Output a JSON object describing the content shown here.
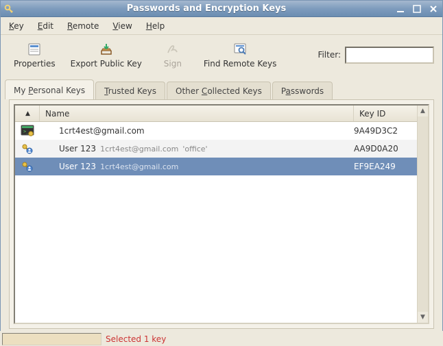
{
  "window": {
    "title": "Passwords and Encryption Keys"
  },
  "menu": {
    "key": "Key",
    "edit": "Edit",
    "remote": "Remote",
    "view": "View",
    "help": "Help"
  },
  "toolbar": {
    "properties": "Properties",
    "export": "Export Public Key",
    "sign": "Sign",
    "find_remote": "Find Remote Keys",
    "filter_label": "Filter:",
    "filter_value": ""
  },
  "tabs": {
    "personal": "My Personal Keys",
    "trusted": "Trusted Keys",
    "collected": "Other Collected Keys",
    "passwords": "Passwords",
    "active": "personal"
  },
  "columns": {
    "name": "Name",
    "keyid": "Key ID"
  },
  "rows": [
    {
      "icon": "terminal",
      "primary": "1crt4est@gmail.com",
      "secondary": "",
      "note": "",
      "keyid": "9A49D3C2",
      "selected": false
    },
    {
      "icon": "keypair",
      "primary": "User 123",
      "secondary": "1crt4est@gmail.com",
      "note": "'office'",
      "keyid": "AA9D0A20",
      "selected": false
    },
    {
      "icon": "keypair",
      "primary": "User 123",
      "secondary": "1crt4est@gmail.com",
      "note": "",
      "keyid": "EF9EA249",
      "selected": true
    }
  ],
  "status": {
    "text": "Selected 1 key"
  }
}
